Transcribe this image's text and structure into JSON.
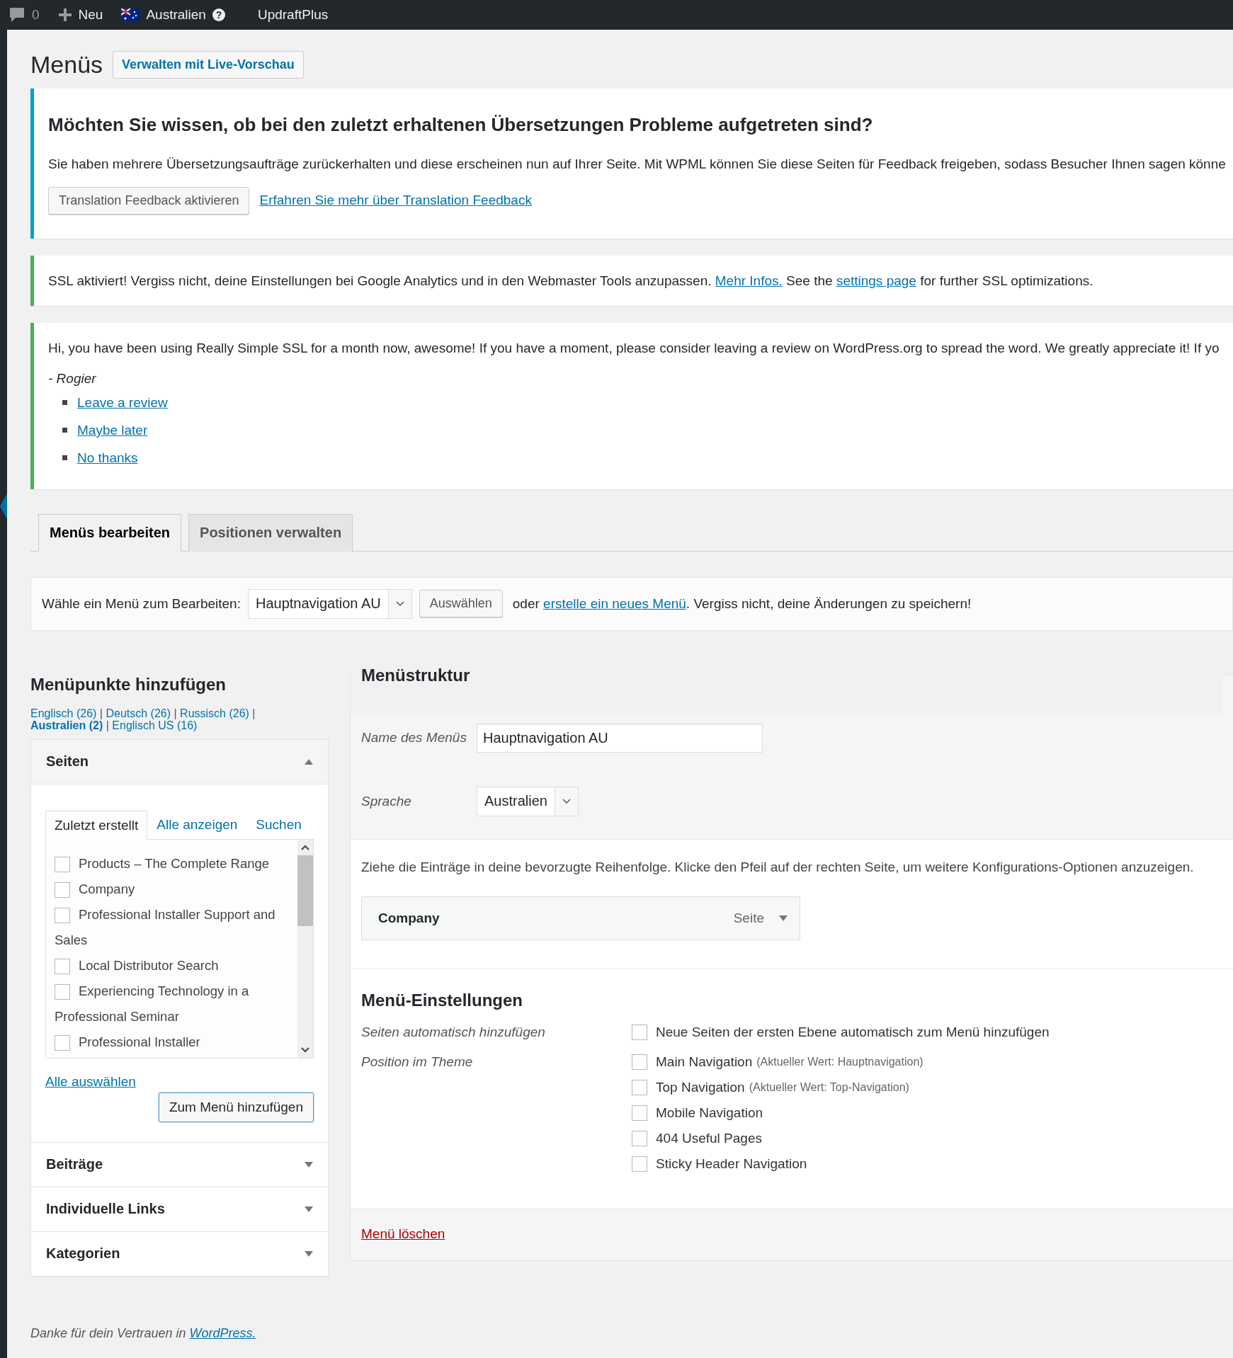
{
  "admin_bar": {
    "comments_count": "0",
    "new_label": "Neu",
    "language_label": "Australien",
    "help_glyph": "?",
    "plugin_label": "UpdraftPlus"
  },
  "page": {
    "title": "Menüs",
    "live_preview_button": "Verwalten mit Live-Vorschau"
  },
  "notices": [
    {
      "kind": "translation",
      "color": "#00a0d2",
      "heading": "Möchten Sie wissen, ob bei den zuletzt erhaltenen Übersetzungen Probleme aufgetreten sind?",
      "text": "Sie haben mehrere Übersetzungsaufträge zurückerhalten und diese erscheinen nun auf Ihrer Seite. Mit WPML können Sie diese Seiten für Feedback freigeben, sodass Besucher Ihnen sagen könne",
      "button": "Translation Feedback aktivieren",
      "link": "Erfahren Sie mehr über Translation Feedback"
    },
    {
      "kind": "ssl",
      "color": "#46b450",
      "parts": [
        {
          "kind": "text",
          "text": "SSL aktiviert!  Vergiss nicht, deine Einstellungen bei Google Analytics und in den Webmaster Tools anzupassen. "
        },
        {
          "kind": "link",
          "text": "Mehr Infos."
        },
        {
          "kind": "text",
          "text": " See the "
        },
        {
          "kind": "link",
          "text": "settings page"
        },
        {
          "kind": "text",
          "text": " for further SSL optimizations."
        }
      ]
    },
    {
      "kind": "review",
      "color": "#46b450",
      "text": "Hi, you have been using Really Simple SSL for a month now, awesome! If you have a moment, please consider leaving a review on WordPress.org to spread the word. We greatly appreciate it! If yo",
      "signature": "- Rogier",
      "links": [
        "Leave a review",
        "Maybe later",
        "No thanks"
      ]
    }
  ],
  "tabs": [
    {
      "label": "Menüs bearbeiten",
      "selected": true
    },
    {
      "label": "Positionen verwalten",
      "selected": false
    }
  ],
  "menu_select": {
    "parts": [
      {
        "kind": "text",
        "text": "Wähle ein Menü zum Bearbeiten:"
      },
      {
        "kind": "select",
        "text": "Hauptnavigation AU"
      },
      {
        "kind": "button",
        "text": "Auswählen"
      },
      {
        "kind": "text",
        "text": "oder "
      },
      {
        "kind": "link",
        "text": "erstelle ein neues Menü"
      },
      {
        "kind": "text",
        "text": ". Vergiss nicht, deine Änderungen zu speichern!"
      }
    ]
  },
  "add_items": {
    "heading": "Menüpunkte hinzufügen",
    "language_filter": {
      "separator": "|",
      "items": [
        {
          "label": "Englisch (26)",
          "selected": false
        },
        {
          "label": "Deutsch (26)",
          "selected": false
        },
        {
          "label": "Russisch (26)",
          "selected": false
        },
        {
          "label": "Australien (2)",
          "selected": true
        },
        {
          "label": "Englisch US (16)",
          "selected": false
        }
      ]
    },
    "sections": [
      {
        "title": "Seiten",
        "expanded": true,
        "subtabs": [
          {
            "label": "Zuletzt erstellt",
            "selected": true
          },
          {
            "label": "Alle anzeigen",
            "selected": false
          },
          {
            "label": "Suchen",
            "selected": false
          }
        ],
        "pages": [
          {
            "label": "Products – The Complete Range",
            "checked": false
          },
          {
            "label": "Company",
            "checked": false
          },
          {
            "label": "Professional Installer Support and Sales",
            "checked": false
          },
          {
            "label": "Local Distributor Search",
            "checked": false
          },
          {
            "label": "Experiencing Technology in a Professional Seminar",
            "checked": false
          },
          {
            "label": "Professional Installer",
            "checked": false
          }
        ],
        "select_all": "Alle auswählen",
        "add_button": "Zum Menü hinzufügen"
      },
      {
        "title": "Beiträge",
        "expanded": false
      },
      {
        "title": "Individuelle Links",
        "expanded": false
      },
      {
        "title": "Kategorien",
        "expanded": false
      }
    ]
  },
  "structure": {
    "heading": "Menüstruktur",
    "name_field": {
      "label": "Name des Menüs",
      "value": "Hauptnavigation AU"
    },
    "language_select": {
      "label": "Sprache",
      "value": "Australien"
    },
    "instructions": "Ziehe die Einträge in deine bevorzugte Reihenfolge. Klicke den Pfeil auf der rechten Seite, um weitere Konfigurations-Optionen anzuzeigen.",
    "menu_items": [
      {
        "title": "Company",
        "type": "Seite"
      }
    ],
    "settings": {
      "heading": "Menü-Einstellungen",
      "auto_add": {
        "label": "Seiten automatisch hinzufügen",
        "options": [
          {
            "label": "Neue Seiten der ersten Ebene automatisch zum Menü hinzufügen",
            "checked": false
          }
        ]
      },
      "position": {
        "label": "Position im Theme",
        "locations": [
          {
            "label": "Main Navigation",
            "note": "(Aktueller Wert: Hauptnavigation)",
            "checked": false
          },
          {
            "label": "Top Navigation",
            "note": "(Aktueller Wert: Top-Navigation)",
            "checked": false
          },
          {
            "label": "Mobile Navigation",
            "checked": false
          },
          {
            "label": "404 Useful Pages",
            "checked": false
          },
          {
            "label": "Sticky Header Navigation",
            "checked": false
          }
        ]
      }
    },
    "delete_link": "Menü löschen"
  },
  "footer": {
    "text": "Danke für dein Vertrauen in ",
    "link": "WordPress."
  }
}
